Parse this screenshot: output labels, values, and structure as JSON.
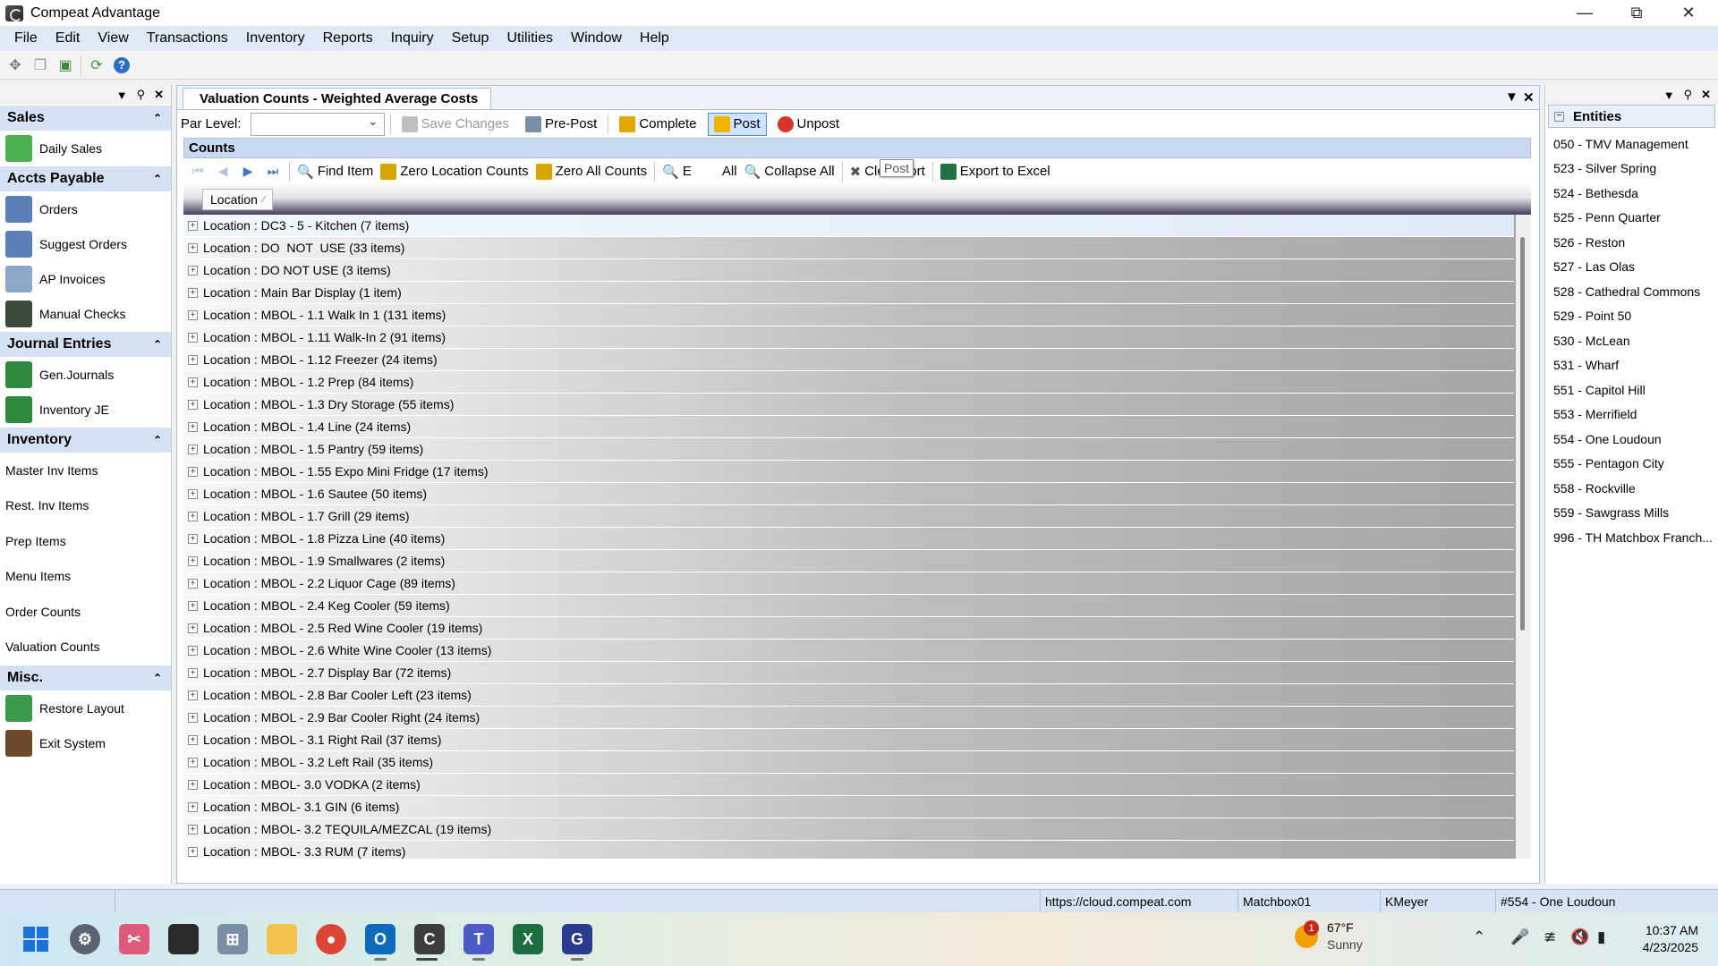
{
  "window": {
    "title": "Compeat Advantage"
  },
  "menu": [
    "File",
    "Edit",
    "View",
    "Transactions",
    "Inventory",
    "Reports",
    "Inquiry",
    "Setup",
    "Utilities",
    "Window",
    "Help"
  ],
  "leftnav": {
    "groups": [
      {
        "title": "Sales",
        "items": [
          {
            "label": "Daily Sales",
            "icon": "daily-sales-icon",
            "color": "#4caf50"
          }
        ]
      },
      {
        "title": "Accts Payable",
        "items": [
          {
            "label": "Orders",
            "icon": "orders-icon",
            "color": "#5b7fb8"
          },
          {
            "label": "Suggest Orders",
            "icon": "suggest-orders-icon",
            "color": "#5b7fb8"
          },
          {
            "label": "AP Invoices",
            "icon": "ap-invoices-icon",
            "color": "#8aa8c8"
          },
          {
            "label": "Manual Checks",
            "icon": "manual-checks-icon",
            "color": "#3b4a3b"
          }
        ]
      },
      {
        "title": "Journal Entries",
        "items": [
          {
            "label": "Gen.Journals",
            "icon": "gen-journals-icon",
            "color": "#2e8b3e"
          },
          {
            "label": "Inventory JE",
            "icon": "inventory-je-icon",
            "color": "#2e8b3e"
          }
        ]
      },
      {
        "title": "Inventory",
        "items": [
          {
            "label": "Master Inv Items",
            "icon": "",
            "color": ""
          },
          {
            "label": "Rest. Inv Items",
            "icon": "",
            "color": ""
          },
          {
            "label": "Prep Items",
            "icon": "",
            "color": ""
          },
          {
            "label": "Menu Items",
            "icon": "",
            "color": ""
          },
          {
            "label": "Order Counts",
            "icon": "",
            "color": ""
          },
          {
            "label": "Valuation Counts",
            "icon": "",
            "color": ""
          }
        ]
      },
      {
        "title": "Misc.",
        "items": [
          {
            "label": "Restore Layout",
            "icon": "restore-layout-icon",
            "color": "#3a9a4a"
          },
          {
            "label": "Exit System",
            "icon": "exit-system-icon",
            "color": "#6b4a2a"
          }
        ]
      }
    ]
  },
  "doc": {
    "tab_title": "Valuation Counts - Weighted Average Costs",
    "par_level_label": "Par Level:",
    "par_level_value": "",
    "buttons": {
      "save_changes": "Save Changes",
      "pre_post": "Pre-Post",
      "complete": "Complete",
      "post": "Post",
      "unpost": "Unpost"
    },
    "counts_header": "Counts",
    "grid_tools": {
      "find_item": "Find Item",
      "zero_location": "Zero Location Counts",
      "zero_all": "Zero All Counts",
      "expand_all_partial_1": "E",
      "expand_all_partial_2": "All",
      "collapse_all": "Collapse All",
      "clear_sort": "Clear Sort",
      "export_excel": "Export to Excel"
    },
    "tooltip": "Post",
    "group_by_column": "Location",
    "rows": [
      "Location : DC3 - 5 - Kitchen (7 items)",
      "Location : DO  NOT  USE (33 items)",
      "Location : DO NOT USE (3 items)",
      "Location : Main Bar Display (1 item)",
      "Location : MBOL - 1.1 Walk In 1 (131 items)",
      "Location : MBOL - 1.11 Walk-In 2 (91 items)",
      "Location : MBOL - 1.12 Freezer (24 items)",
      "Location : MBOL - 1.2 Prep (84 items)",
      "Location : MBOL - 1.3 Dry Storage (55 items)",
      "Location : MBOL - 1.4 Line (24 items)",
      "Location : MBOL - 1.5 Pantry (59 items)",
      "Location : MBOL - 1.55 Expo Mini Fridge (17 items)",
      "Location : MBOL - 1.6 Sautee (50 items)",
      "Location : MBOL - 1.7 Grill (29 items)",
      "Location : MBOL - 1.8 Pizza Line (40 items)",
      "Location : MBOL - 1.9 Smallwares (2 items)",
      "Location : MBOL - 2.2 Liquor Cage (89 items)",
      "Location : MBOL - 2.4 Keg Cooler (59 items)",
      "Location : MBOL - 2.5 Red Wine Cooler (19 items)",
      "Location : MBOL - 2.6 White Wine Cooler (13 items)",
      "Location : MBOL - 2.7 Display Bar (72 items)",
      "Location : MBOL - 2.8 Bar Cooler Left (23 items)",
      "Location : MBOL - 2.9 Bar Cooler Right (24 items)",
      "Location : MBOL - 3.1 Right Rail (37 items)",
      "Location : MBOL - 3.2 Left Rail (35 items)",
      "Location : MBOL- 3.0 VODKA (2 items)",
      "Location : MBOL- 3.1 GIN (6 items)",
      "Location : MBOL- 3.2 TEQUILA/MEZCAL (19 items)",
      "Location : MBOL- 3.3 RUM (7 items)"
    ]
  },
  "entities": {
    "title": "Entities",
    "items": [
      "050 - TMV Management",
      "523 - Silver Spring",
      "524 - Bethesda",
      "525 - Penn Quarter",
      "526 - Reston",
      "527 - Las Olas",
      "528 - Cathedral Commons",
      "529 - Point 50",
      "530 - McLean",
      "531 - Wharf",
      "551 - Capitol Hill",
      "553 - Merrifield",
      "554 - One Loudoun",
      "555 - Pentagon City",
      "558 - Rockville",
      "559 - Sawgrass Mills",
      "996 - TH Matchbox Franch..."
    ]
  },
  "status": {
    "url": "https://cloud.compeat.com",
    "db": "Matchbox01",
    "user": "KMeyer",
    "entity": "#554 - One Loudoun"
  },
  "taskbar": {
    "weather_temp": "67°F",
    "weather_desc": "Sunny",
    "weather_badge": "1",
    "time": "10:37 AM",
    "date": "4/23/2025"
  }
}
